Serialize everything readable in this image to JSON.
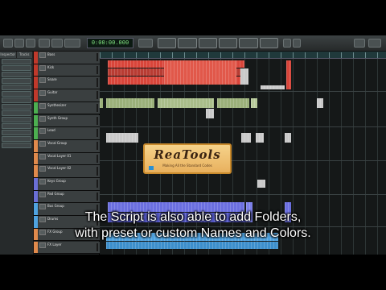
{
  "subtitle": {
    "line1": "The Script is also able to add Folders,",
    "line2": "with preset or custom Names and Colors."
  },
  "logo": {
    "title": "ReaTools",
    "subtitle": "Making All the Standard Codes"
  },
  "inspector": {
    "tabs": [
      "Inspector",
      "Tracks"
    ]
  },
  "toolbar": {
    "time_display": "0:00:00.000"
  },
  "tracks": [
    {
      "name": "Bass",
      "color": "#c0392b"
    },
    {
      "name": "Kick",
      "color": "#c0392b"
    },
    {
      "name": "Snare",
      "color": "#c0392b"
    },
    {
      "name": "Guitar",
      "color": "#c0392b"
    },
    {
      "name": "Synthesizer",
      "color": "#4caf50"
    },
    {
      "name": "Synth Group",
      "color": "#4caf50"
    },
    {
      "name": "Lead",
      "color": "#4caf50"
    },
    {
      "name": "Vocal Group",
      "color": "#e08a4c"
    },
    {
      "name": "Vocal Layer 01",
      "color": "#e08a4c"
    },
    {
      "name": "Vocal Layer 02",
      "color": "#e08a4c"
    },
    {
      "name": "Keys Group",
      "color": "#6a6fd6"
    },
    {
      "name": "Pad Group",
      "color": "#6a6fd6"
    },
    {
      "name": "Bus Group",
      "color": "#4fa3e0"
    },
    {
      "name": "Drums",
      "color": "#4fa3e0"
    },
    {
      "name": "FX Group",
      "color": "#e08a4c"
    },
    {
      "name": "FX Layer",
      "color": "#e08a4c"
    }
  ],
  "colors": {
    "drums_events": "#d9453a",
    "synth_events": "#9bb07a",
    "keys_events": "#6b6fe0",
    "bus_events": "#4fa3e0",
    "neutral_events": "#c9c9c9"
  }
}
